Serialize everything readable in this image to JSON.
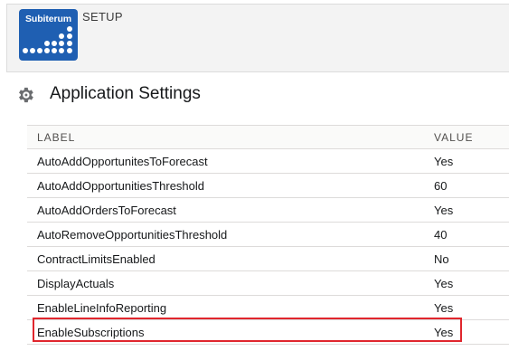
{
  "header": {
    "logo_text": "Subiterum",
    "section_label": "SETUP"
  },
  "page": {
    "title": "Application Settings",
    "icon": "gear-icon"
  },
  "table": {
    "columns": {
      "label": "LABEL",
      "value": "VALUE"
    },
    "rows": [
      {
        "label": "AutoAddOpportunitesToForecast",
        "value": "Yes"
      },
      {
        "label": "AutoAddOpportunitiesThreshold",
        "value": "60"
      },
      {
        "label": "AutoAddOrdersToForecast",
        "value": "Yes"
      },
      {
        "label": "AutoRemoveOpportunitiesThreshold",
        "value": "40"
      },
      {
        "label": "ContractLimitsEnabled",
        "value": "No"
      },
      {
        "label": "DisplayActuals",
        "value": "Yes"
      },
      {
        "label": "EnableLineInfoReporting",
        "value": "Yes"
      },
      {
        "label": "EnableSubscriptions",
        "value": "Yes",
        "highlighted": true
      }
    ]
  },
  "colors": {
    "brand": "#1f5fb2",
    "highlight_border": "#e0262d",
    "header_bg": "#f3f3f3"
  }
}
